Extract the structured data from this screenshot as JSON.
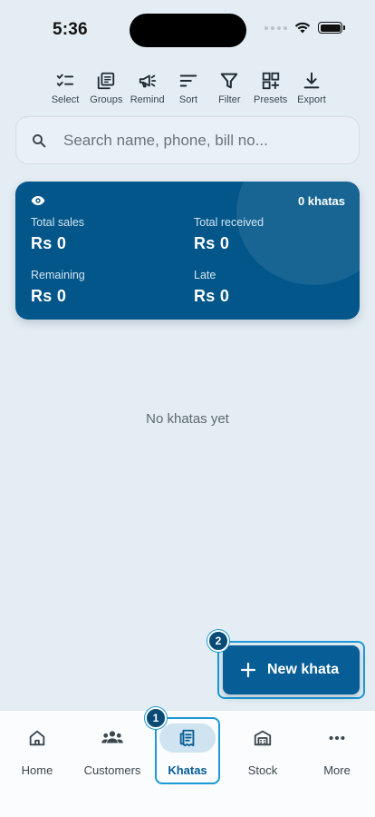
{
  "status_bar": {
    "time": "5:36"
  },
  "toolbar": {
    "items": [
      {
        "label": "Select",
        "icon": "select-list-icon"
      },
      {
        "label": "Groups",
        "icon": "groups-icon"
      },
      {
        "label": "Remind",
        "icon": "megaphone-icon"
      },
      {
        "label": "Sort",
        "icon": "sort-icon"
      },
      {
        "label": "Filter",
        "icon": "filter-icon"
      },
      {
        "label": "Presets",
        "icon": "presets-icon"
      },
      {
        "label": "Export",
        "icon": "download-icon"
      }
    ]
  },
  "search": {
    "placeholder": "Search name, phone, bill no..."
  },
  "summary": {
    "count": "0 khatas",
    "total_sales_label": "Total sales",
    "total_sales_value": "Rs 0",
    "total_received_label": "Total received",
    "total_received_value": "Rs 0",
    "remaining_label": "Remaining",
    "remaining_value": "Rs 0",
    "late_label": "Late",
    "late_value": "Rs 0"
  },
  "empty_state": "No khatas yet",
  "fab": {
    "label": "New khata"
  },
  "markers": {
    "nav": "1",
    "fab": "2"
  },
  "nav": {
    "items": [
      {
        "label": "Home",
        "icon": "home-icon"
      },
      {
        "label": "Customers",
        "icon": "customers-icon"
      },
      {
        "label": "Khatas",
        "icon": "khatas-icon",
        "active": true
      },
      {
        "label": "Stock",
        "icon": "stock-icon"
      },
      {
        "label": "More",
        "icon": "more-icon"
      }
    ]
  },
  "colors": {
    "primary": "#075d95",
    "card": "#02568a",
    "highlight": "#1a9ad6",
    "background": "#e4edf3"
  }
}
